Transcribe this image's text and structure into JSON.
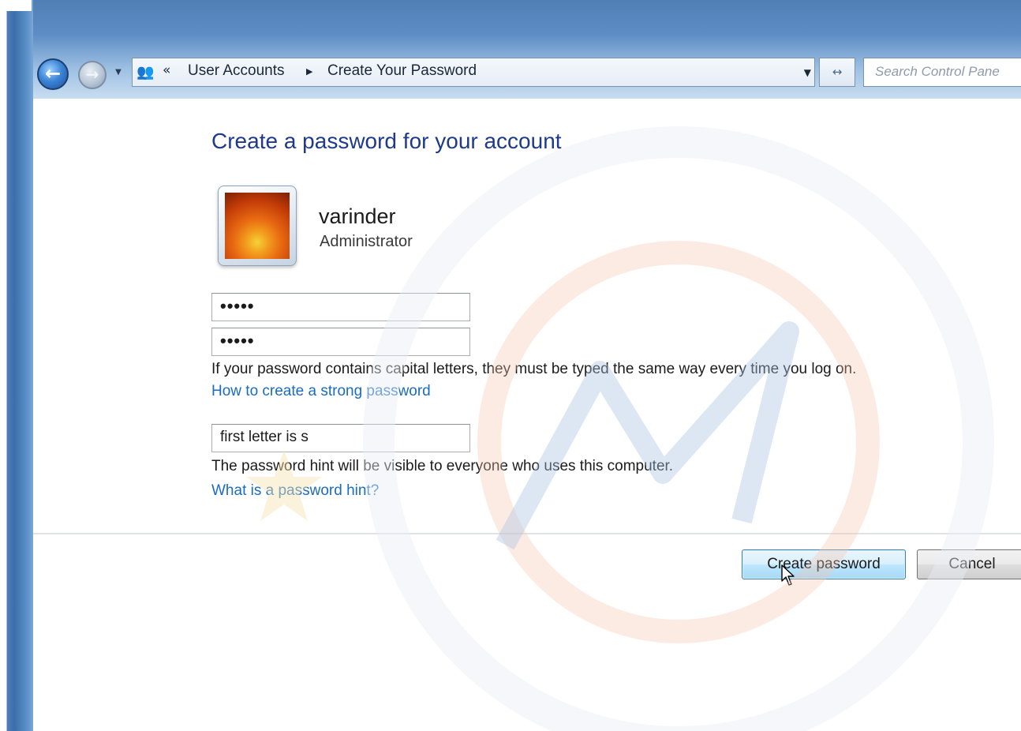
{
  "navigation": {
    "breadcrumb": [
      "User Accounts",
      "Create Your Password"
    ],
    "search_placeholder": "Search Control Pane"
  },
  "page": {
    "title": "Create a password for your account"
  },
  "user": {
    "name": "varinder",
    "role": "Administrator"
  },
  "form": {
    "new_password_value": "•••••",
    "confirm_password_value": "•••••",
    "capital_letters_note": "If your password contains capital letters, they must be typed the same way every time you log on.",
    "strong_password_link": "How to create a strong password",
    "hint_value": "first letter is s",
    "hint_note": "The password hint will be visible to everyone who uses this computer.",
    "hint_link": "What is a password hint?"
  },
  "buttons": {
    "create": "Create password",
    "cancel": "Cancel"
  },
  "icons": {
    "back": "back-arrow-icon",
    "forward": "forward-arrow-icon",
    "user_accounts": "user-accounts-icon",
    "refresh": "refresh-icon",
    "cursor": "mouse-pointer-icon"
  },
  "colors": {
    "title": "#1e3a8a",
    "link": "#1a6cc1",
    "frame": "#4f7fb5"
  }
}
